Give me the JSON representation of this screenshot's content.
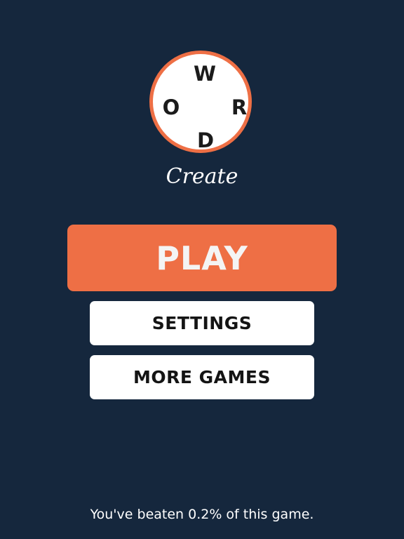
{
  "logo": {
    "letters": {
      "top": "W",
      "left": "O",
      "right": "R",
      "bottom": "D"
    },
    "subtitle": "Create",
    "ring_color": "#ee6f45"
  },
  "menu": {
    "play_label": "PLAY",
    "settings_label": "SETTINGS",
    "more_games_label": "MORE GAMES"
  },
  "footer": {
    "progress_text": "You've beaten 0.2% of this game."
  },
  "colors": {
    "background": "#15273d",
    "accent": "#ee6f45",
    "button_white": "#ffffff"
  }
}
